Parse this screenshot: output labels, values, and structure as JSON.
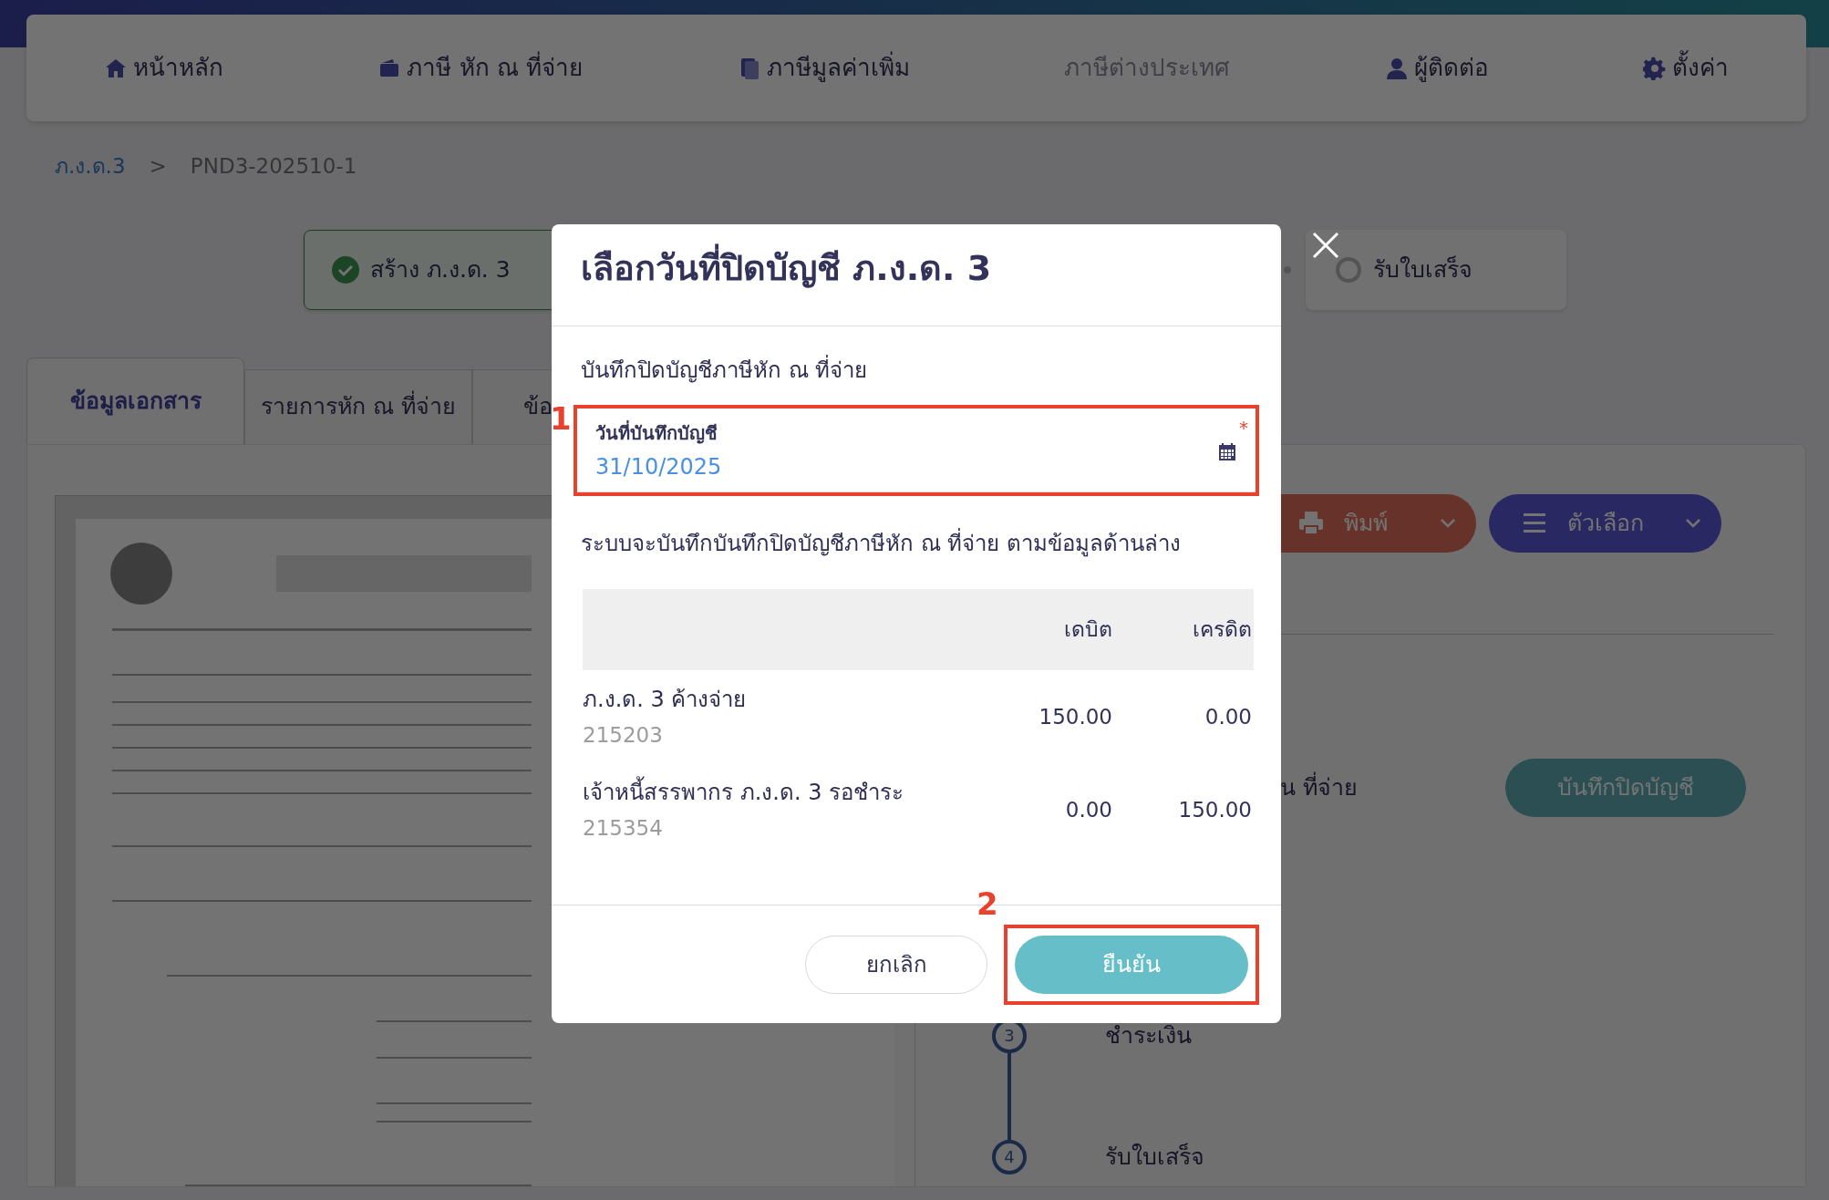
{
  "navbar": {
    "items": [
      {
        "label": "หน้าหลัก",
        "disabled": false
      },
      {
        "label": "ภาษี หัก ณ ที่จ่าย",
        "disabled": false
      },
      {
        "label": "ภาษีมูลค่าเพิ่ม",
        "disabled": false
      },
      {
        "label": "ภาษีต่างประเทศ",
        "disabled": true
      },
      {
        "label": "ผู้ติดต่อ",
        "disabled": false
      },
      {
        "label": "ตั้งค่า",
        "disabled": false
      }
    ]
  },
  "breadcrumb": [
    {
      "label": "ภ.ง.ด.3",
      "kind": "link"
    },
    {
      "label": ">",
      "kind": "separator"
    },
    {
      "label": "PND3-202510-1",
      "kind": "current"
    }
  ],
  "steps": [
    {
      "label": "สร้าง ภ.ง.ด. 3",
      "done": true
    },
    {
      "label": "รับใบเสร็จ",
      "done": false
    }
  ],
  "tabs": [
    {
      "label": "ข้อมูลเอกสาร",
      "selected": true
    },
    {
      "label": "รายการหัก ณ ที่จ่าย",
      "selected": false
    },
    {
      "label": "ข้อ",
      "selected": false
    }
  ],
  "actions": [
    {
      "kind": "print",
      "label": "พิมพ์"
    },
    {
      "kind": "options",
      "label": "ตัวเลือก"
    }
  ],
  "close_section": {
    "text": "น ที่จ่าย",
    "button": "บันทึกปิดบัญชี"
  },
  "timeline": [
    {
      "number": "3",
      "label": "ชำระเงิน"
    },
    {
      "number": "4",
      "label": "รับใบเสร็จ"
    }
  ],
  "modal": {
    "title": "เลือกวันที่ปิดบัญชี ภ.ง.ด. 3",
    "subtitle": "บันทึกปิดบัญชีภาษีหัก ณ ที่จ่าย",
    "field": {
      "label": "วันที่บันทึกบัญชี",
      "value": "31/10/2025",
      "required_mark": "*"
    },
    "description": "ระบบจะบันทึกบันทึกปิดบัญชีภาษีหัก ณ ที่จ่าย ตามข้อมูลด้านล่าง",
    "table": {
      "columns": [
        "เดบิต",
        "เครดิต"
      ],
      "rows": [
        {
          "account": "ภ.ง.ด. 3 ค้างจ่าย",
          "code": "215203",
          "debit": "150.00",
          "credit": "0.00"
        },
        {
          "account": "เจ้าหนี้สรรพากร ภ.ง.ด. 3 รอชำระ",
          "code": "215354",
          "debit": "0.00",
          "credit": "150.00"
        }
      ]
    },
    "cancel": "ยกเลิก",
    "confirm": "ยืนยัน"
  },
  "annotations": [
    {
      "label": "1"
    },
    {
      "label": "2"
    }
  ]
}
